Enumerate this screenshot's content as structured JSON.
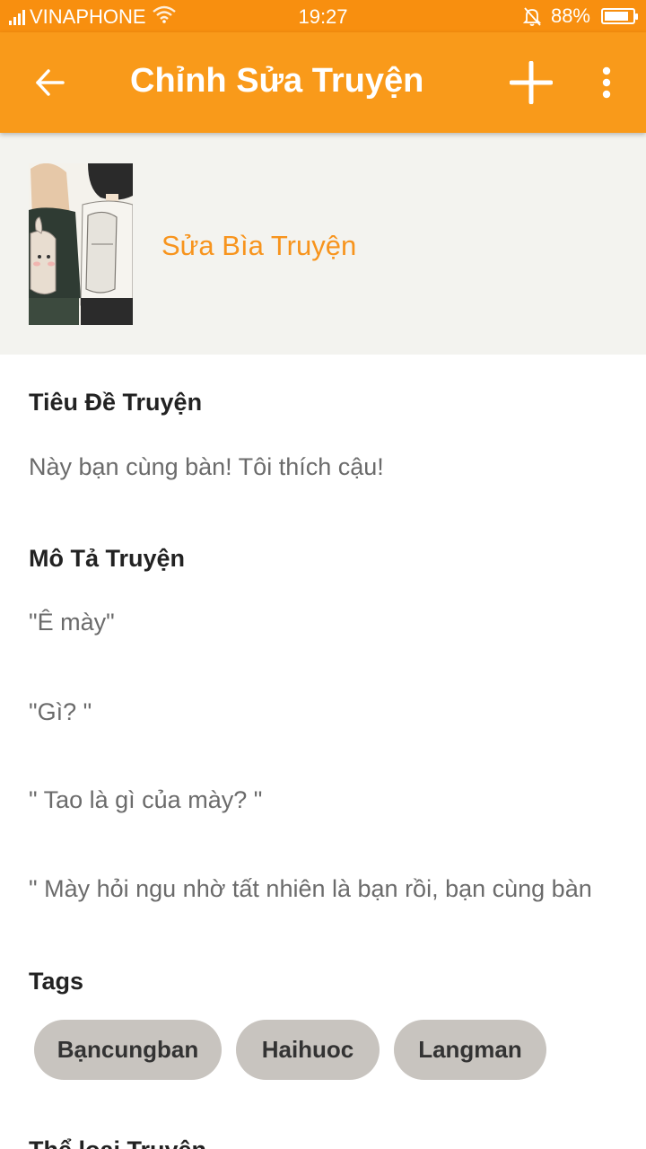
{
  "status_bar": {
    "carrier": "VINAPHONE",
    "time": "19:27",
    "battery_percent": "88%",
    "battery_level": 0.88
  },
  "app_bar": {
    "title": "Chỉnh Sửa Truyện",
    "back_icon": "arrow-left-icon",
    "add_icon": "plus-icon",
    "menu_icon": "more-vertical-icon"
  },
  "cover": {
    "edit_label": "Sửa Bìa Truyện"
  },
  "story": {
    "title_label": "Tiêu Đề Truyện",
    "title_value": "Này bạn cùng bàn! Tôi thích cậu!",
    "description_label": "Mô Tả Truyện",
    "description_lines": [
      "\"Ê mày\"",
      "\"Gì? \"",
      "\" Tao là gì của mày? \"",
      "\" Mày hỏi ngu nhờ tất nhiên là bạn rồi, bạn cùng bàn"
    ],
    "tags_label": "Tags",
    "tags": [
      "Bạncungban",
      "Haihuoc",
      "Langman"
    ],
    "genre_label": "Thể loại Truyện"
  },
  "colors": {
    "accent": "#f99a1a",
    "status_bar": "#f88f0f",
    "link": "#f7941d",
    "tag_bg": "#c8c4bf",
    "cover_bg": "#f3f3ef"
  }
}
